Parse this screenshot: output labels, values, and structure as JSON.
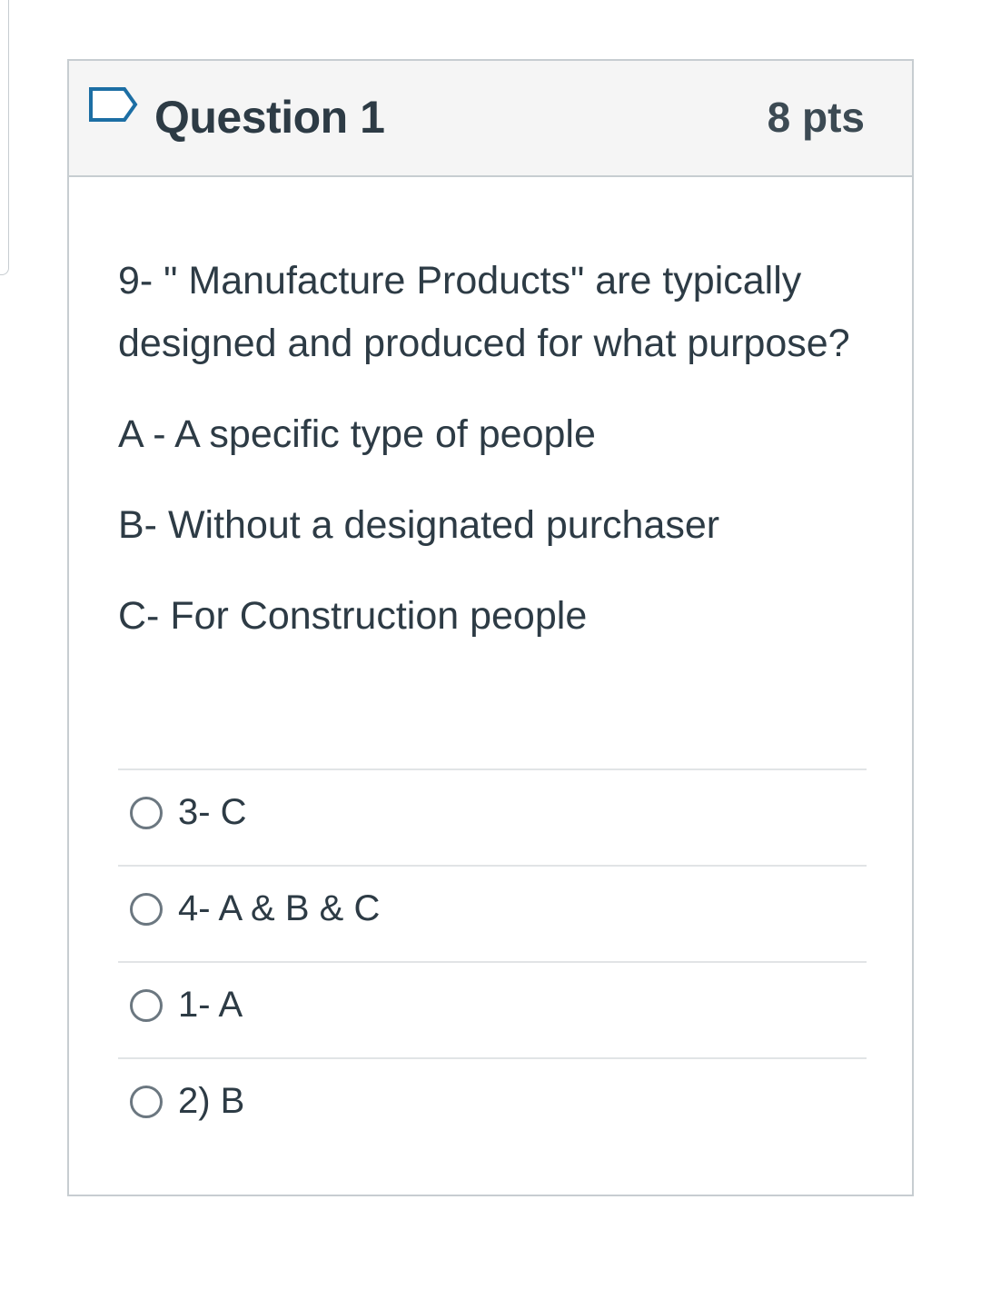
{
  "question": {
    "title": "Question 1",
    "points": "8 pts",
    "prompt": "9- \" Manufacture Products\" are typically designed and produced for what purpose?",
    "choices_text": [
      "A - A specific type of people",
      "B-  Without a designated purchaser",
      "C- For Construction people"
    ]
  },
  "answers": [
    {
      "label": "3- C",
      "selected": false
    },
    {
      "label": "4- A & B & C",
      "selected": false
    },
    {
      "label": "1- A",
      "selected": false
    },
    {
      "label": "2) B",
      "selected": false
    }
  ],
  "icons": {
    "flag": "flag-question-icon",
    "radio": "radio-button-icon"
  },
  "colors": {
    "header_bg": "#f5f5f5",
    "border": "#c7cdd1",
    "text": "#2d3b45",
    "flag_blue": "#1c6ea4"
  }
}
